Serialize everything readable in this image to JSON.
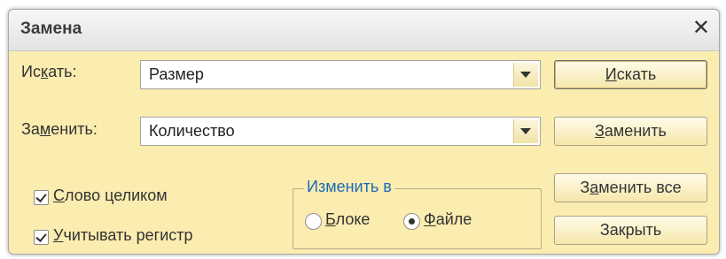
{
  "dialog": {
    "title": "Замена",
    "close_glyph": "✕"
  },
  "search": {
    "label_pre": "Ис",
    "label_u": "к",
    "label_post": "ать:",
    "value": "Размер"
  },
  "replace": {
    "label_pre": "За",
    "label_u": "м",
    "label_post": "енить:",
    "value": "Количество"
  },
  "buttons": {
    "find": {
      "pre": "",
      "u": "И",
      "post": "скать"
    },
    "replace": {
      "pre": "",
      "u": "З",
      "post": "аменить"
    },
    "replace_all": {
      "pre": "З",
      "u": "а",
      "post": "менить все"
    },
    "close": {
      "label": "Закрыть"
    }
  },
  "options": {
    "whole_word": {
      "u": "С",
      "post": "лово целиком",
      "checked": true
    },
    "match_case": {
      "u": "У",
      "post": "читывать регистр",
      "checked": true
    }
  },
  "scope": {
    "title": "Изменить в",
    "block": {
      "u": "Б",
      "post": "локе",
      "selected": false
    },
    "file": {
      "u": "Ф",
      "post": "айле",
      "selected": true
    }
  }
}
